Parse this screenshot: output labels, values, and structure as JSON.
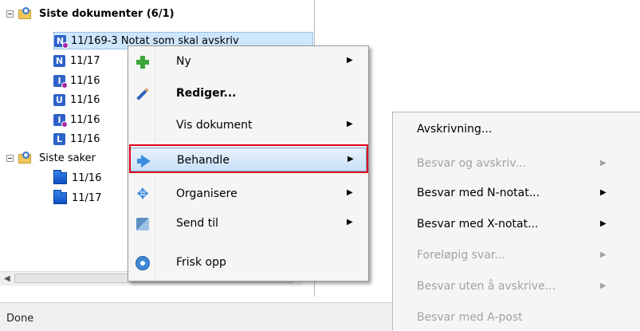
{
  "tree": {
    "group1": {
      "label": "Siste dokumenter (6/1)"
    },
    "group2": {
      "label": "Siste saker"
    },
    "docs": [
      {
        "letter": "N",
        "color": "#2f62c9",
        "text": "11/169-3 Notat som skal avskriv",
        "badge": true
      },
      {
        "letter": "N",
        "color": "#2f62c9",
        "text": "11/17",
        "badge": false
      },
      {
        "letter": "I",
        "color": "#2f62c9",
        "text": "11/16",
        "badge": true
      },
      {
        "letter": "U",
        "color": "#2f62c9",
        "text": "11/16",
        "badge": false
      },
      {
        "letter": "I",
        "color": "#2f62c9",
        "text": "11/16",
        "badge": true
      },
      {
        "letter": "L",
        "color": "#2f62c9",
        "text": "11/16",
        "badge": false
      }
    ],
    "cases": [
      {
        "text": "11/16"
      },
      {
        "text": "11/17"
      }
    ]
  },
  "status": {
    "text": "Done"
  },
  "context_menu": {
    "items": [
      {
        "label": "Ny",
        "icon": "plus-icon",
        "submenu": true,
        "bold": false
      },
      {
        "label": "Rediger...",
        "icon": "pencil-icon",
        "submenu": false,
        "bold": true
      },
      {
        "label": "Vis dokument",
        "icon": "",
        "submenu": true,
        "bold": false
      },
      {
        "label": "Behandle",
        "icon": "arrow-icon",
        "submenu": true,
        "bold": false,
        "active": true
      },
      {
        "label": "Organisere",
        "icon": "move-icon",
        "submenu": true,
        "bold": false
      },
      {
        "label": "Send til",
        "icon": "sendto-icon",
        "submenu": true,
        "bold": false
      },
      {
        "label": "Frisk opp",
        "icon": "refresh-icon",
        "submenu": false,
        "bold": false
      }
    ]
  },
  "sub_menu": {
    "items": [
      {
        "label": "Avskrivning...",
        "enabled": true,
        "submenu": false
      },
      {
        "label": "Besvar og avskriv...",
        "enabled": false,
        "submenu": true
      },
      {
        "label": "Besvar med N-notat...",
        "enabled": true,
        "submenu": true
      },
      {
        "label": "Besvar med X-notat...",
        "enabled": true,
        "submenu": true
      },
      {
        "label": "Foreløpig svar...",
        "enabled": false,
        "submenu": true
      },
      {
        "label": "Besvar uten å avskrive...",
        "enabled": false,
        "submenu": true
      },
      {
        "label": "Besvar med A-post",
        "enabled": false,
        "submenu": false
      }
    ]
  },
  "highlight_color": "#e0001b"
}
